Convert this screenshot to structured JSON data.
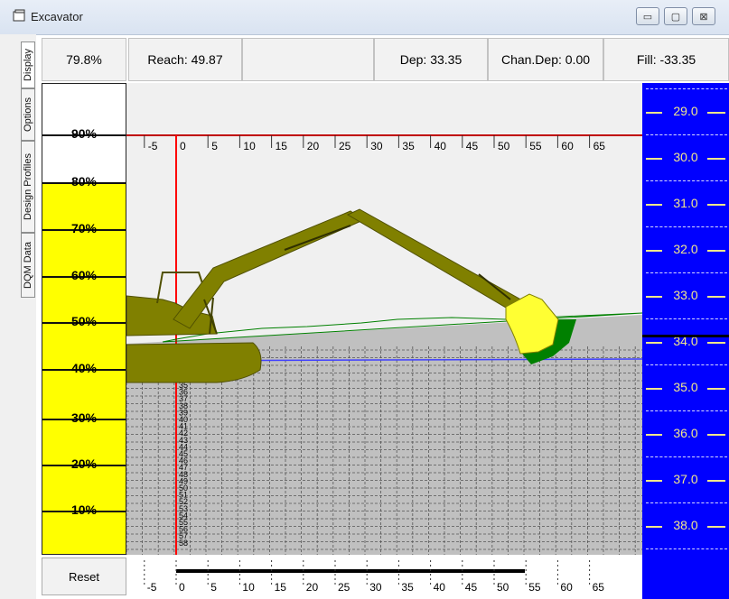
{
  "window": {
    "title": "Excavator",
    "minimize_symbol": "▭",
    "maximize_symbol": "▢",
    "close_symbol": "⊠"
  },
  "tabs": [
    "Display",
    "Options",
    "Design Profiles",
    "DQM Data"
  ],
  "header": {
    "percent": "79.8%",
    "reach": "Reach: 49.87",
    "depth": "Dep: 33.35",
    "channel_depth": "Chan.Dep: 0.00",
    "fill": "Fill: -33.35"
  },
  "gauge": {
    "value_percent": 79.8,
    "labels": [
      "90%",
      "80%",
      "70%",
      "60%",
      "50%",
      "40%",
      "30%",
      "20%",
      "10%"
    ],
    "fill_color": "#ffff00"
  },
  "scale": {
    "top_labels": [
      "-5",
      "0",
      "5",
      "10",
      "15",
      "20",
      "25",
      "30",
      "35",
      "40",
      "45",
      "50",
      "55",
      "60",
      "65"
    ],
    "bottom_labels": [
      "-5",
      "0",
      "5",
      "10",
      "15",
      "20",
      "25",
      "30",
      "35",
      "40",
      "45",
      "50",
      "55",
      "60",
      "65"
    ],
    "depth_marks": [
      "30",
      "31",
      "32",
      "33",
      "34",
      "35",
      "36",
      "37",
      "38",
      "39",
      "40",
      "41",
      "42",
      "43",
      "44",
      "45",
      "46",
      "47",
      "48",
      "49",
      "50",
      "51",
      "52",
      "53",
      "54",
      "55",
      "56",
      "57",
      "58"
    ]
  },
  "depth_scale": {
    "labels": [
      "29.0",
      "30.0",
      "31.0",
      "32.0",
      "33.0",
      "34.0",
      "35.0",
      "36.0",
      "37.0",
      "38.0"
    ],
    "background": "#0000ff",
    "label_color": "#f0e68c"
  },
  "colors": {
    "excavator": "#808000",
    "bucket": "#ffff33",
    "spoil": "#008000",
    "seabed": "#c0c0c0",
    "reference_line": "#c00000",
    "design_line": "#4040ff"
  },
  "buttons": {
    "reset": "Reset"
  }
}
